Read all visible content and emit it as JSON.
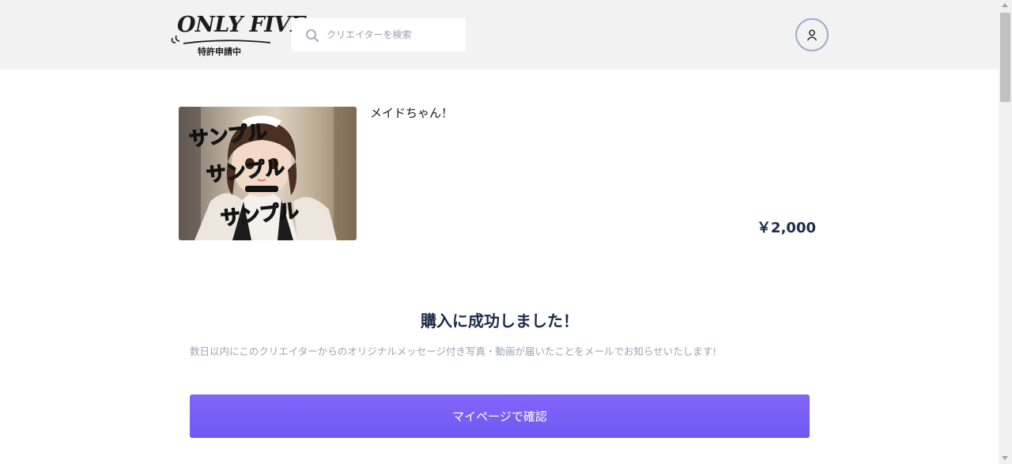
{
  "header": {
    "logo": {
      "text": "ONLY FIVE",
      "subtext": "特許申請中"
    },
    "search": {
      "placeholder": "クリエイターを検索",
      "icon": "search-icon"
    },
    "user_icon": "user-icon"
  },
  "product": {
    "title": "メイドちゃん！",
    "price": "￥2,000",
    "thumbnail": {
      "overlay_text": [
        "サンプル",
        "サンプル",
        "サンプル"
      ]
    }
  },
  "purchase": {
    "title": "購入に成功しました！",
    "message": "数日以内にこのクリエイターからのオリジナルメッセージ付き写真・動画が届いたことをメールでお知らせいたします!",
    "button_label": "マイページで確認"
  },
  "colors": {
    "header_bg": "#f2f2f2",
    "accent": "#7b62f8",
    "title": "#1b2a48",
    "muted_text": "#9ea3b6",
    "user_ring": "#a3a6cc"
  }
}
